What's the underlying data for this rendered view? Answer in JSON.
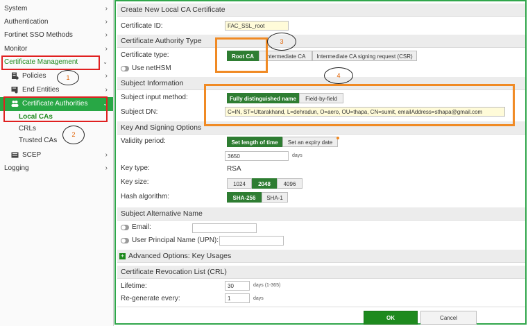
{
  "sidebar": {
    "items": [
      {
        "label": "System"
      },
      {
        "label": "Authentication"
      },
      {
        "label": "Fortinet SSO Methods"
      },
      {
        "label": "Monitor"
      },
      {
        "label": "Certificate Management"
      },
      {
        "label": "Policies"
      },
      {
        "label": "End Entities"
      },
      {
        "label": "Certificate Authorities"
      },
      {
        "label": "Local CAs"
      },
      {
        "label": "CRLs"
      },
      {
        "label": "Trusted CAs"
      },
      {
        "label": "SCEP"
      },
      {
        "label": "Logging"
      }
    ]
  },
  "annotations": {
    "one": "1",
    "two": "2",
    "three": "3",
    "four": "4"
  },
  "form": {
    "title": "Create New Local CA Certificate",
    "certificate_id_label": "Certificate ID:",
    "certificate_id_value": "FAC_SSL_root",
    "ca_type_section": "Certificate Authority Type",
    "certificate_type_label": "Certificate type:",
    "certificate_type_options": [
      "Root CA",
      "Intermediate CA",
      "Intermediate CA signing request (CSR)"
    ],
    "use_nethsm_label": "Use netHSM",
    "subject_section": "Subject Information",
    "subject_input_method_label": "Subject input method:",
    "subject_input_method_options": [
      "Fully distinguished name",
      "Field-by-field"
    ],
    "subject_dn_label": "Subject DN:",
    "subject_dn_value": "C=IN, ST=Uttarakhand, L=dehradun, O=aero, OU=thapa, CN=sumit, emailAddress=sthapa@gmail.com",
    "key_section": "Key And Signing Options",
    "validity_period_label": "Validity period:",
    "validity_options": [
      "Set length of time",
      "Set an expiry date"
    ],
    "validity_value": "3650",
    "validity_unit": "days",
    "key_type_label": "Key type:",
    "key_type_value": "RSA",
    "key_size_label": "Key size:",
    "key_size_options": [
      "1024",
      "2048",
      "4096"
    ],
    "hash_label": "Hash algorithm:",
    "hash_options": [
      "SHA-256",
      "SHA-1"
    ],
    "san_section": "Subject Alternative Name",
    "email_label": "Email:",
    "upn_label": "User Principal Name (UPN):",
    "advanced_section": "Advanced Options: Key Usages",
    "crl_section": "Certificate Revocation List (CRL)",
    "lifetime_label": "Lifetime:",
    "lifetime_value": "30",
    "lifetime_unit": "days (1-365)",
    "regen_label": "Re-generate every:",
    "regen_value": "1",
    "regen_unit": "days",
    "ok_label": "OK",
    "cancel_label": "Cancel"
  },
  "colors": {
    "active_green": "#28a745",
    "selected_button": "#2e7d32",
    "highlight_red": "#e02020",
    "highlight_orange": "#f08a24",
    "border_green": "#2fa64a"
  }
}
